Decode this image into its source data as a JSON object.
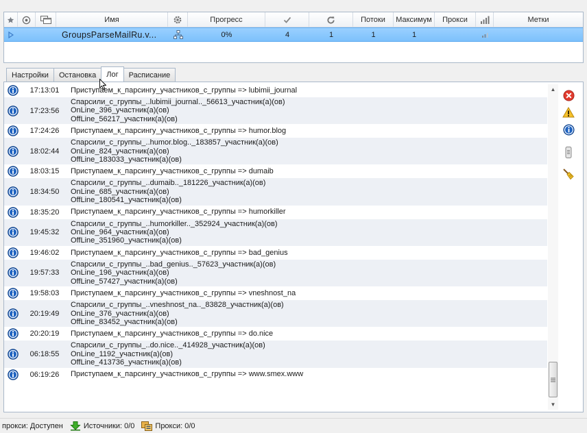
{
  "grid": {
    "headers": [
      "Имя",
      "Прогресс",
      "Потоки",
      "Максимум",
      "Прокси",
      "Метки"
    ],
    "row": {
      "name": "GroupsParseMailRu.v...",
      "progress": "0%",
      "success": "4",
      "repeats": "1",
      "threads": "1",
      "maximum": "1"
    }
  },
  "tabs": [
    "Настройки",
    "Остановка",
    "Лог",
    "Расписание"
  ],
  "active_tab": "Лог",
  "log": [
    {
      "time": "17:13:01",
      "lines": [
        "Приступаем_к_парсингу_участников_с_группы => lubimii_journal"
      ]
    },
    {
      "time": "17:23:56",
      "lines": [
        "Спарсили_с_группы_..lubimii_journal.._56613_участник(а)(ов)",
        "OnLine_396_участник(а)(ов)",
        "OffLine_56217_участник(а)(ов)"
      ]
    },
    {
      "time": "17:24:26",
      "lines": [
        "Приступаем_к_парсингу_участников_с_группы => humor.blog"
      ]
    },
    {
      "time": "18:02:44",
      "lines": [
        "Спарсили_с_группы_..humor.blog.._183857_участник(а)(ов)",
        "OnLine_824_участник(а)(ов)",
        "OffLine_183033_участник(а)(ов)"
      ]
    },
    {
      "time": "18:03:15",
      "lines": [
        "Приступаем_к_парсингу_участников_с_группы => dumaib"
      ]
    },
    {
      "time": "18:34:50",
      "lines": [
        "Спарсили_с_группы_..dumaib.._181226_участник(а)(ов)",
        "OnLine_685_участник(а)(ов)",
        "OffLine_180541_участник(а)(ов)"
      ]
    },
    {
      "time": "18:35:20",
      "lines": [
        "Приступаем_к_парсингу_участников_с_группы => humorkiller"
      ]
    },
    {
      "time": "19:45:32",
      "lines": [
        "Спарсили_с_группы_..humorkiller.._352924_участник(а)(ов)",
        "OnLine_964_участник(а)(ов)",
        "OffLine_351960_участник(а)(ов)"
      ]
    },
    {
      "time": "19:46:02",
      "lines": [
        "Приступаем_к_парсингу_участников_с_группы => bad_genius"
      ]
    },
    {
      "time": "19:57:33",
      "lines": [
        "Спарсили_с_группы_..bad_genius.._57623_участник(а)(ов)",
        "OnLine_196_участник(а)(ов)",
        "OffLine_57427_участник(а)(ов)"
      ]
    },
    {
      "time": "19:58:03",
      "lines": [
        "Приступаем_к_парсингу_участников_с_группы => vneshnost_na"
      ]
    },
    {
      "time": "20:19:49",
      "lines": [
        "Спарсили_с_группы_..vneshnost_na.._83828_участник(а)(ов)",
        "OnLine_376_участник(а)(ов)",
        "OffLine_83452_участник(а)(ов)"
      ]
    },
    {
      "time": "20:20:19",
      "lines": [
        "Приступаем_к_парсингу_участников_с_группы => do.nice"
      ]
    },
    {
      "time": "06:18:55",
      "lines": [
        "Спарсили_с_группы_..do.nice.._414928_участник(а)(ов)",
        "OnLine_1192_участник(а)(ов)",
        "OffLine_413736_участник(а)(ов)"
      ]
    },
    {
      "time": "06:19:26",
      "lines": [
        "Приступаем_к_парсингу_участников_с_группы => www.smex.www"
      ]
    }
  ],
  "status": {
    "proxy_text": "прокси: Доступен",
    "sources_text": "Источники: 0/0",
    "proxies_text": "Прокси: 0/0"
  },
  "icons": {
    "log_entry": "info-icon",
    "clear": "red-x-icon",
    "warning": "warning-icon",
    "info": "info-icon",
    "scroll_lock": "scroll-icon",
    "broom": "broom-icon"
  },
  "colors": {
    "selected_row": "#8ccaff",
    "info_icon": "#1f63c0",
    "alt_row": "#edf0f5"
  }
}
